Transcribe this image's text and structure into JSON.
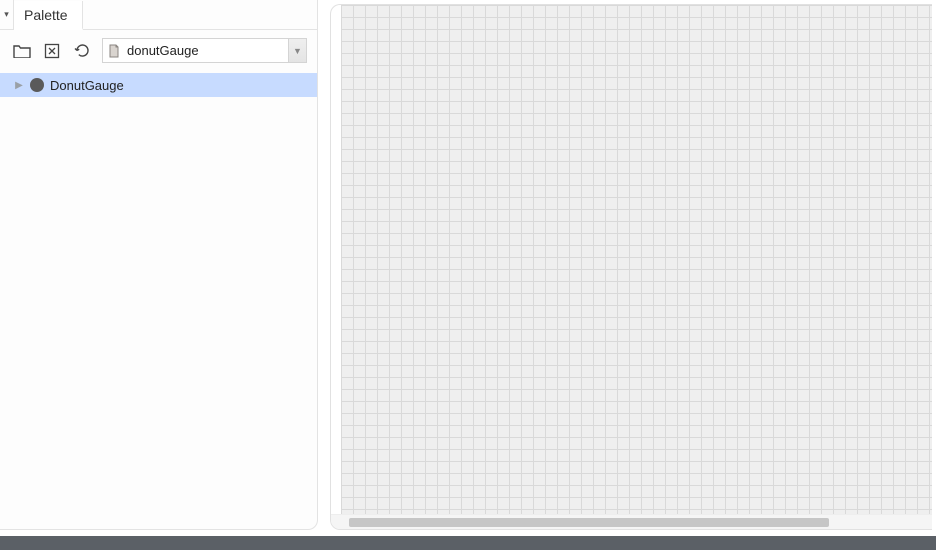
{
  "palette": {
    "tab_label": "Palette",
    "search": {
      "selected": "donutGauge"
    },
    "tree_items": [
      {
        "label": "DonutGauge",
        "selected": true
      }
    ]
  }
}
